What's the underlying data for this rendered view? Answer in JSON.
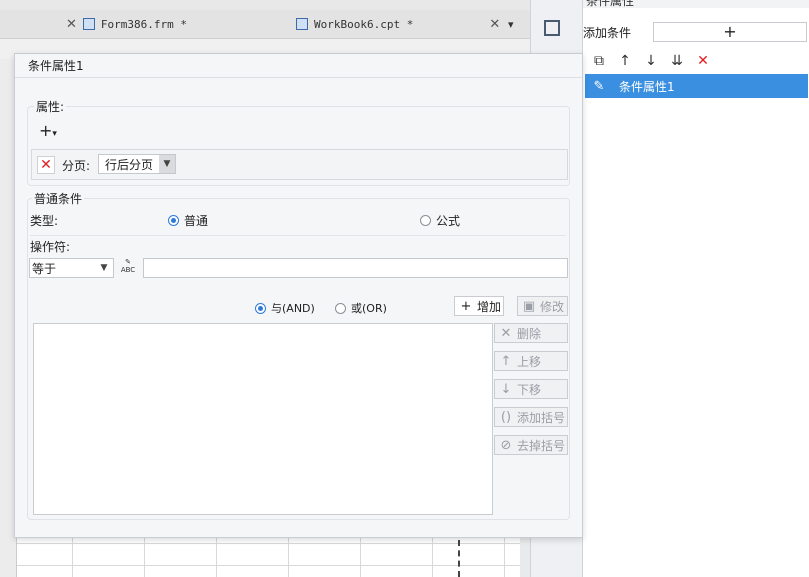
{
  "tabs": [
    {
      "label": "Form386.frm *"
    },
    {
      "label": "WorkBook6.cpt *"
    }
  ],
  "right_panel": {
    "title": "条件属性",
    "add_condition_label": "添加条件",
    "add_button_label": "+",
    "selected_item": "条件属性1"
  },
  "dialog": {
    "title": "条件属性1",
    "property_group": {
      "label": "属性:",
      "pagination_label": "分页:",
      "pagination_value": "行后分页"
    },
    "common_group": {
      "label": "普通条件",
      "type_label": "类型:",
      "type_options": [
        "普通",
        "公式"
      ],
      "type_selected": "普通",
      "operator_label": "操作符:",
      "operator_value": "等于",
      "operand_value": "",
      "logic_options": [
        "与(AND)",
        "或(OR)"
      ],
      "logic_selected": "与(AND)",
      "buttons": {
        "add": "增加",
        "modify": "修改",
        "delete": "删除",
        "move_up": "上移",
        "move_down": "下移",
        "add_bracket": "添加括号",
        "remove_bracket": "去掉括号"
      }
    }
  },
  "icons": {
    "copy": "copy-icon",
    "up": "arrow-up-icon",
    "down": "arrow-down-icon",
    "bottom": "move-bottom-icon",
    "remove": "close-icon",
    "edit": "pencil-icon"
  },
  "colors": {
    "selection": "#3a8fe0",
    "delete_red": "#e02020",
    "radio_on": "#2f7ad8"
  }
}
